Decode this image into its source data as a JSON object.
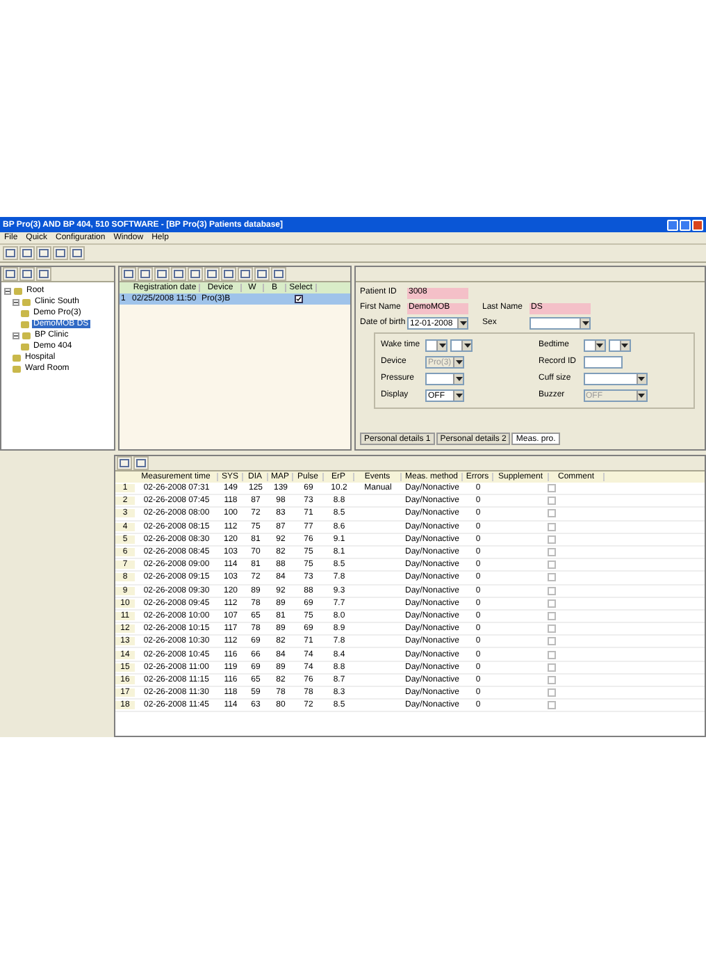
{
  "window": {
    "title": "BP Pro(3) AND BP 404, 510 SOFTWARE - [BP Pro(3) Patients database]"
  },
  "menu": [
    "File",
    "Quick",
    "Configuration",
    "Window",
    "Help"
  ],
  "tree": [
    {
      "label": "Root",
      "expanded": true,
      "selected": false,
      "children": [
        {
          "label": "Clinic South",
          "expanded": true,
          "selected": false,
          "children": [
            {
              "label": "Demo Pro(3)",
              "selected": false
            },
            {
              "label": "DemoMOB DS",
              "selected": true
            }
          ]
        },
        {
          "label": "BP Clinic",
          "expanded": true,
          "selected": false,
          "children": [
            {
              "label": "Demo 404",
              "selected": false
            }
          ]
        },
        {
          "label": "Hospital",
          "selected": false
        },
        {
          "label": "Ward Room",
          "selected": false
        }
      ]
    }
  ],
  "registrations": {
    "columns": [
      "",
      "Registration date",
      "Device",
      "W",
      "B",
      "Select"
    ],
    "rows": [
      {
        "cells": [
          "1",
          "02/25/2008 11:50",
          "Pro(3)B"
        ],
        "selected": true,
        "checked": true
      }
    ]
  },
  "patient": {
    "fields": [
      {
        "label": "Patient ID",
        "value": "3008",
        "required": true
      },
      {
        "label": "First Name",
        "value": "DemoMOB",
        "required": true
      },
      {
        "label": "Last Name",
        "value": "DS",
        "required": true
      }
    ],
    "birth": {
      "label": "Date of birth",
      "value": "12-01-2008"
    },
    "sex": {
      "label": "Sex"
    }
  },
  "settings": [
    {
      "label": "Wake time",
      "kind": "dual",
      "disabled": false
    },
    {
      "label": "Bedtime",
      "kind": "dual",
      "disabled": false
    },
    {
      "label": "Device",
      "kind": "select",
      "disabled": true,
      "value": "Pro(3)"
    },
    {
      "label": "Record ID",
      "kind": "text",
      "disabled": false
    },
    {
      "label": "Pressure",
      "kind": "select",
      "disabled": false
    },
    {
      "label": "Cuff size",
      "kind": "select",
      "disabled": false
    },
    {
      "label": "Display",
      "kind": "select",
      "disabled": false,
      "value": "OFF"
    },
    {
      "label": "Buzzer",
      "kind": "select",
      "disabled": true,
      "value": "OFF"
    }
  ],
  "tabs": [
    {
      "label": "Personal details 1",
      "selected": false
    },
    {
      "label": "Personal details 2",
      "selected": false
    },
    {
      "label": "Meas. pro.",
      "selected": true
    }
  ],
  "measurements": {
    "columns": [
      "",
      "Measurement time",
      "SYS",
      "DIA",
      "MAP",
      "Pulse",
      "ErP",
      "Events",
      "Meas. method",
      "Errors",
      "Supplement",
      "Comment"
    ],
    "rows": [
      {
        "cells": [
          "1",
          "02-26-2008 07:31",
          "149",
          "125",
          "139",
          "69",
          "10.2",
          "Manual",
          "Day/Nonactive",
          "0"
        ],
        "supplement": false
      },
      {
        "cells": [
          "2",
          "02-26-2008 07:45",
          "118",
          "87",
          "98",
          "73",
          "8.8",
          "",
          "Day/Nonactive",
          "0"
        ],
        "supplement": false
      },
      {
        "cells": [
          "3",
          "02-26-2008 08:00",
          "100",
          "72",
          "83",
          "71",
          "8.5",
          "",
          "Day/Nonactive",
          "0"
        ],
        "supplement": false
      },
      {
        "cells": [
          "4",
          "02-26-2008 08:15",
          "112",
          "75",
          "87",
          "77",
          "8.6",
          "",
          "Day/Nonactive",
          "0"
        ],
        "supplement": false
      },
      {
        "cells": [
          "5",
          "02-26-2008 08:30",
          "120",
          "81",
          "92",
          "76",
          "9.1",
          "",
          "Day/Nonactive",
          "0"
        ],
        "supplement": false
      },
      {
        "cells": [
          "6",
          "02-26-2008 08:45",
          "103",
          "70",
          "82",
          "75",
          "8.1",
          "",
          "Day/Nonactive",
          "0"
        ],
        "supplement": false
      },
      {
        "cells": [
          "7",
          "02-26-2008 09:00",
          "114",
          "81",
          "88",
          "75",
          "8.5",
          "",
          "Day/Nonactive",
          "0"
        ],
        "supplement": false
      },
      {
        "cells": [
          "8",
          "02-26-2008 09:15",
          "103",
          "72",
          "84",
          "73",
          "7.8",
          "",
          "Day/Nonactive",
          "0"
        ],
        "supplement": false
      },
      {
        "cells": [
          "9",
          "02-26-2008 09:30",
          "120",
          "89",
          "92",
          "88",
          "9.3",
          "",
          "Day/Nonactive",
          "0"
        ],
        "supplement": false
      },
      {
        "cells": [
          "10",
          "02-26-2008 09:45",
          "112",
          "78",
          "89",
          "69",
          "7.7",
          "",
          "Day/Nonactive",
          "0"
        ],
        "supplement": false
      },
      {
        "cells": [
          "11",
          "02-26-2008 10:00",
          "107",
          "65",
          "81",
          "75",
          "8.0",
          "",
          "Day/Nonactive",
          "0"
        ],
        "supplement": false
      },
      {
        "cells": [
          "12",
          "02-26-2008 10:15",
          "117",
          "78",
          "89",
          "69",
          "8.9",
          "",
          "Day/Nonactive",
          "0"
        ],
        "supplement": false
      },
      {
        "cells": [
          "13",
          "02-26-2008 10:30",
          "112",
          "69",
          "82",
          "71",
          "7.8",
          "",
          "Day/Nonactive",
          "0"
        ],
        "supplement": false
      },
      {
        "cells": [
          "14",
          "02-26-2008 10:45",
          "116",
          "66",
          "84",
          "74",
          "8.4",
          "",
          "Day/Nonactive",
          "0"
        ],
        "supplement": false
      },
      {
        "cells": [
          "15",
          "02-26-2008 11:00",
          "119",
          "69",
          "89",
          "74",
          "8.8",
          "",
          "Day/Nonactive",
          "0"
        ],
        "supplement": false
      },
      {
        "cells": [
          "16",
          "02-26-2008 11:15",
          "116",
          "65",
          "82",
          "76",
          "8.7",
          "",
          "Day/Nonactive",
          "0"
        ],
        "supplement": false
      },
      {
        "cells": [
          "17",
          "02-26-2008 11:30",
          "118",
          "59",
          "78",
          "78",
          "8.3",
          "",
          "Day/Nonactive",
          "0"
        ],
        "supplement": false
      },
      {
        "cells": [
          "18",
          "02-26-2008 11:45",
          "114",
          "63",
          "80",
          "72",
          "8.5",
          "",
          "Day/Nonactive",
          "0"
        ],
        "supplement": false
      }
    ]
  }
}
